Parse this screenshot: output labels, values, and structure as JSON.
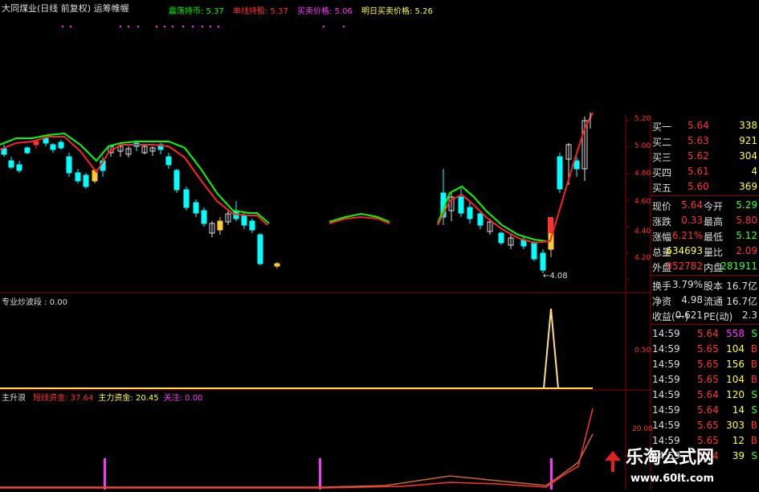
{
  "header": {
    "title": "大同煤业(日线 前复权) 运筹帷幄",
    "indicators": [
      {
        "label": "震荡持币",
        "value": "5.37",
        "color": "#00ff00"
      },
      {
        "label": "单线持股",
        "value": "5.37",
        "color": "#ff3333"
      },
      {
        "label": "买卖价格",
        "value": "5.06",
        "color": "#ff33ff"
      },
      {
        "label": "明日买卖价格",
        "value": "5.26",
        "color": "#ffff33"
      }
    ]
  },
  "price_axis": {
    "ticks": [
      "5.20",
      "5.00",
      "4.80",
      "4.60",
      "4.40",
      "4.20"
    ]
  },
  "low_annotation": "←4.08",
  "panel2": {
    "label": "专业炒波段",
    "value": "0.00",
    "axis_tick": "0.50"
  },
  "panel3": {
    "prefix": "主升浪",
    "items": [
      {
        "label": "短线资金",
        "value": "37.64",
        "color": "#ff3333"
      },
      {
        "label": "主力资金",
        "value": "20.45",
        "color": "#ffff33"
      },
      {
        "label": "关注",
        "value": "0.00",
        "color": "#ff33ff"
      }
    ],
    "axis_tick": "20.00"
  },
  "order_book": [
    {
      "label": "买一",
      "price": "5.64",
      "volume": "338"
    },
    {
      "label": "买二",
      "price": "5.63",
      "volume": "921"
    },
    {
      "label": "买三",
      "price": "5.62",
      "volume": "304"
    },
    {
      "label": "买四",
      "price": "5.61",
      "volume": "4"
    },
    {
      "label": "买五",
      "price": "5.60",
      "volume": "369"
    }
  ],
  "quote": [
    {
      "l1": "现价",
      "v1": "5.64",
      "l2": "今开",
      "v2": "5.29",
      "c1": "#ff3333",
      "c2": "#33ff33"
    },
    {
      "l1": "涨跌",
      "v1": "0.33",
      "l2": "最高",
      "v2": "5.80",
      "c1": "#ff3333",
      "c2": "#ff3333"
    },
    {
      "l1": "涨幅",
      "v1": "6.21%",
      "l2": "最低",
      "v2": "5.12",
      "c1": "#ff3333",
      "c2": "#33ff33"
    },
    {
      "l1": "总量",
      "v1": "634693",
      "l2": "量比",
      "v2": "2.09",
      "c1": "#ffff33",
      "c2": "#ff3333"
    },
    {
      "l1": "外盘",
      "v1": "352782",
      "l2": "内盘",
      "v2": "281911",
      "c1": "#ff3333",
      "c2": "#33ff33"
    }
  ],
  "fundamentals": [
    {
      "l1": "换手",
      "v1": "3.79%",
      "l2": "股本",
      "v2": "16.7亿"
    },
    {
      "l1": "净资",
      "v1": "4.98",
      "l2": "流通",
      "v2": "16.7亿"
    },
    {
      "l1": "收益(一)",
      "v1": "0.621",
      "l2": "PE(动)",
      "v2": "2.3"
    }
  ],
  "ticks": [
    {
      "time": "14:59",
      "price": "5.64",
      "vol": "558",
      "side": "S",
      "vcolor": "#ff33ff",
      "scolor": "#33ff33"
    },
    {
      "time": "14:59",
      "price": "5.65",
      "vol": "104",
      "side": "B",
      "vcolor": "#ffff33",
      "scolor": "#ff3333"
    },
    {
      "time": "14:59",
      "price": "5.65",
      "vol": "156",
      "side": "B",
      "vcolor": "#ffff33",
      "scolor": "#ff3333"
    },
    {
      "time": "14:59",
      "price": "5.65",
      "vol": "104",
      "side": "B",
      "vcolor": "#ffff33",
      "scolor": "#ff3333"
    },
    {
      "time": "14:59",
      "price": "5.64",
      "vol": "120",
      "side": "S",
      "vcolor": "#ffff33",
      "scolor": "#33ff33"
    },
    {
      "time": "14:59",
      "price": "5.64",
      "vol": "14",
      "side": "S",
      "vcolor": "#ffff33",
      "scolor": "#33ff33"
    },
    {
      "time": "14:59",
      "price": "5.65",
      "vol": "303",
      "side": "B",
      "vcolor": "#ffff33",
      "scolor": "#ff3333"
    },
    {
      "time": "14:59",
      "price": "5.65",
      "vol": "12",
      "side": "B",
      "vcolor": "#ffff33",
      "scolor": "#ff3333"
    },
    {
      "time": "14:59",
      "price": "5.64",
      "vol": "39",
      "side": "S",
      "vcolor": "#ffff33",
      "scolor": "#33ff33"
    }
  ],
  "watermark": {
    "title": "乐淘公式网",
    "url": "www.60lt.com"
  },
  "colors": {
    "up": "#ff3333",
    "down": "#00ffff",
    "grid": "#8b0000",
    "green_line": "#00ff00",
    "red_line": "#ff2020",
    "yellow": "#ffff33",
    "magenta": "#ff33ff"
  }
}
